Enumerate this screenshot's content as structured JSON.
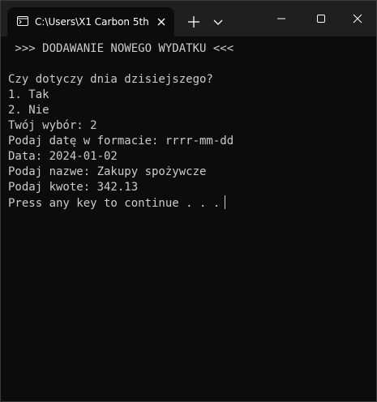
{
  "window": {
    "tab_title": "C:\\Users\\X1 Carbon 5th\\",
    "icons": {
      "terminal": "terminal-icon",
      "close_tab": "close-icon",
      "new_tab": "plus-icon",
      "dropdown": "chevron-down-icon",
      "minimize": "minimize-icon",
      "maximize": "maximize-icon",
      "close_window": "close-icon"
    }
  },
  "console": {
    "lines": [
      " >>> DODAWANIE NOWEGO WYDATKU <<<",
      "Czy dotyczy dnia dzisiejszego?",
      "1. Tak",
      "2. Nie",
      "Twój wybór: 2",
      "Podaj datę w formacie: rrrr-mm-dd",
      "Data: 2024-01-02",
      "Podaj nazwe: Zakupy spożywcze",
      "Podaj kwote: 342.13",
      "Press any key to continue . . ."
    ]
  }
}
